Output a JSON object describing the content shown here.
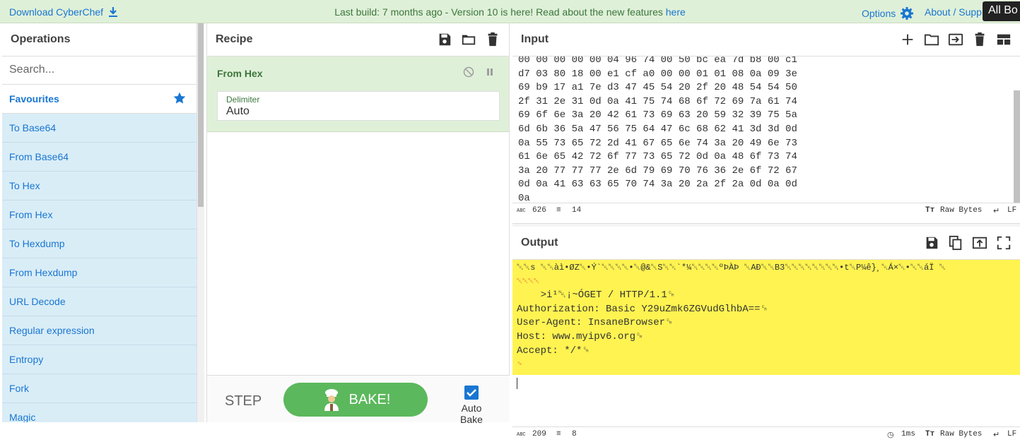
{
  "topbar": {
    "download_label": "Download CyberChef",
    "announcement_prefix": "Last build: 7 months ago - ",
    "announcement_text": "Version 10 is here! Read about the new features ",
    "announcement_link": "here",
    "options_label": "Options",
    "about_label": "About / Supp",
    "tooltip": "All Bo"
  },
  "operations": {
    "title": "Operations",
    "search_placeholder": "Search...",
    "favourites_label": "Favourites",
    "items": [
      "To Base64",
      "From Base64",
      "To Hex",
      "From Hex",
      "To Hexdump",
      "From Hexdump",
      "URL Decode",
      "Regular expression",
      "Entropy",
      "Fork",
      "Magic"
    ]
  },
  "recipe": {
    "title": "Recipe",
    "ingredient": {
      "name": "From Hex",
      "delimiter_label": "Delimiter",
      "delimiter_value": "Auto"
    },
    "step_label": "STEP",
    "bake_label": "BAKE!",
    "auto_bake_label": "Auto Bake",
    "auto_bake_checked": true
  },
  "input": {
    "title": "Input",
    "lines": [
      "00 00 00 00 00 04 96 74 00 50 bc ea 7d b8 00 c1",
      "d7 03 80 18 00 e1 cf a0 00 00 01 01 08 0a 09 3e",
      "69 b9 17 a1 7e d3 47 45 54 20 2f 20 48 54 54 50",
      "2f 31 2e 31 0d 0a 41 75 74 68 6f 72 69 7a 61 74",
      "69 6f 6e 3a 20 42 61 73 69 63 20 59 32 39 75 5a",
      "6d 6b 36 5a 47 56 75 64 47 6c 68 62 41 3d 3d 0d",
      "0a 55 73 65 72 2d 41 67 65 6e 74 3a 20 49 6e 73",
      "61 6e 65 42 72 6f 77 73 65 72 0d 0a 48 6f 73 74",
      "3a 20 77 77 77 2e 6d 79 69 70 76 36 2e 6f 72 67",
      "0d 0a 41 63 63 65 70 74 3a 20 2a 2f 2a 0d 0a 0d",
      "0a"
    ],
    "length": "626",
    "line_count": "14",
    "encoding": "Raw Bytes",
    "eol": "LF"
  },
  "output": {
    "title": "Output",
    "binary_line1": "␀␀s ␀␀àì•ØZ␀•Ý`␀␀␀␀•␀@&␀S␀␀`*¼␀␀␀␀ºÞÀÞ ␀AÐ␀␀B3␀␀␀␀␀␀␀␀•t␀P¼ê}¸␀Á×␀•␀␀áÏ ␀",
    "binary_line2": "␀␀␀␀",
    "lines": [
      "    >i¹␀¡~ÓGET / HTTP/1.1␍",
      "Authorization: Basic Y29uZmk6ZGVudGlhbA==␍",
      "User-Agent: InsaneBrowser␍",
      "Host: www.myipv6.org␍",
      "Accept: */*␍",
      "␍"
    ],
    "length": "209",
    "line_count": "8",
    "time": "1ms",
    "encoding": "Raw Bytes",
    "eol": "LF"
  }
}
